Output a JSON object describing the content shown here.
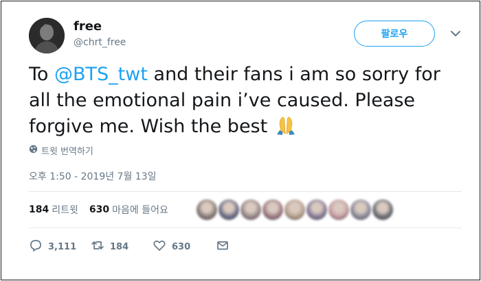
{
  "user": {
    "display_name": "free",
    "handle": "@chrt_free"
  },
  "header": {
    "follow_label": "팔로우",
    "menu_icon": "chevron-down-icon"
  },
  "tweet": {
    "text_prefix": "To ",
    "mention": "@BTS_twt",
    "text_rest": " and their fans i am so sorry for all the emotional pain i’ve caused. Please forgive me. Wish the best",
    "emoji_icon": "folded-hands-icon",
    "translate_label": "트윗 번역하기",
    "timestamp": "오후 1:50 - 2019년 7월 13일"
  },
  "stats": {
    "retweets_count": "184",
    "retweets_label": "리트윗",
    "likes_count": "630",
    "likes_label": "마음에 들어요"
  },
  "liker_faces": [
    "#8a7f7a",
    "#6e7088",
    "#9a8a8c",
    "#a17f86",
    "#b9a28f",
    "#8b7f9c",
    "#c79ea4",
    "#8d8f9d",
    "#6f7278"
  ],
  "actions": {
    "reply_count": "3,111",
    "retweet_count": "184",
    "like_count": "630"
  },
  "colors": {
    "accent": "#1da1f2",
    "muted": "#657786",
    "text": "#14171a"
  }
}
